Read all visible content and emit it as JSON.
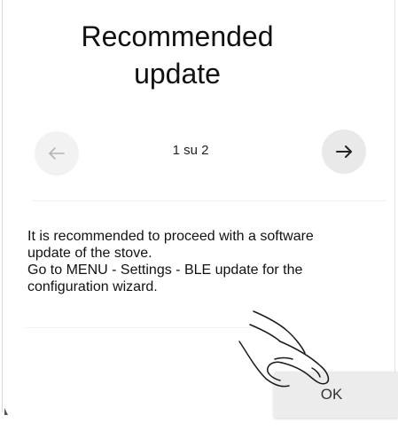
{
  "dialog": {
    "title_line1": "Recommended",
    "title_line2": "update",
    "pager": {
      "text": "1 su 2",
      "prev_icon": "arrow-left-icon",
      "next_icon": "arrow-right-icon"
    },
    "message": {
      "line1": "It is recommended to proceed with a software",
      "line2": "update of the stove.",
      "line3": "Go to MENU - Settings - BLE update for the",
      "line4": "configuration wizard."
    },
    "ok_label": "OK",
    "hand_icon": "tap-hand-icon",
    "colors": {
      "background": "#ffffff",
      "prev_button": "#f2f2f2",
      "next_button": "#e9e9e9",
      "ok_button": "#ececec",
      "prev_arrow": "#b5b5b5",
      "next_arrow": "#222222"
    }
  }
}
